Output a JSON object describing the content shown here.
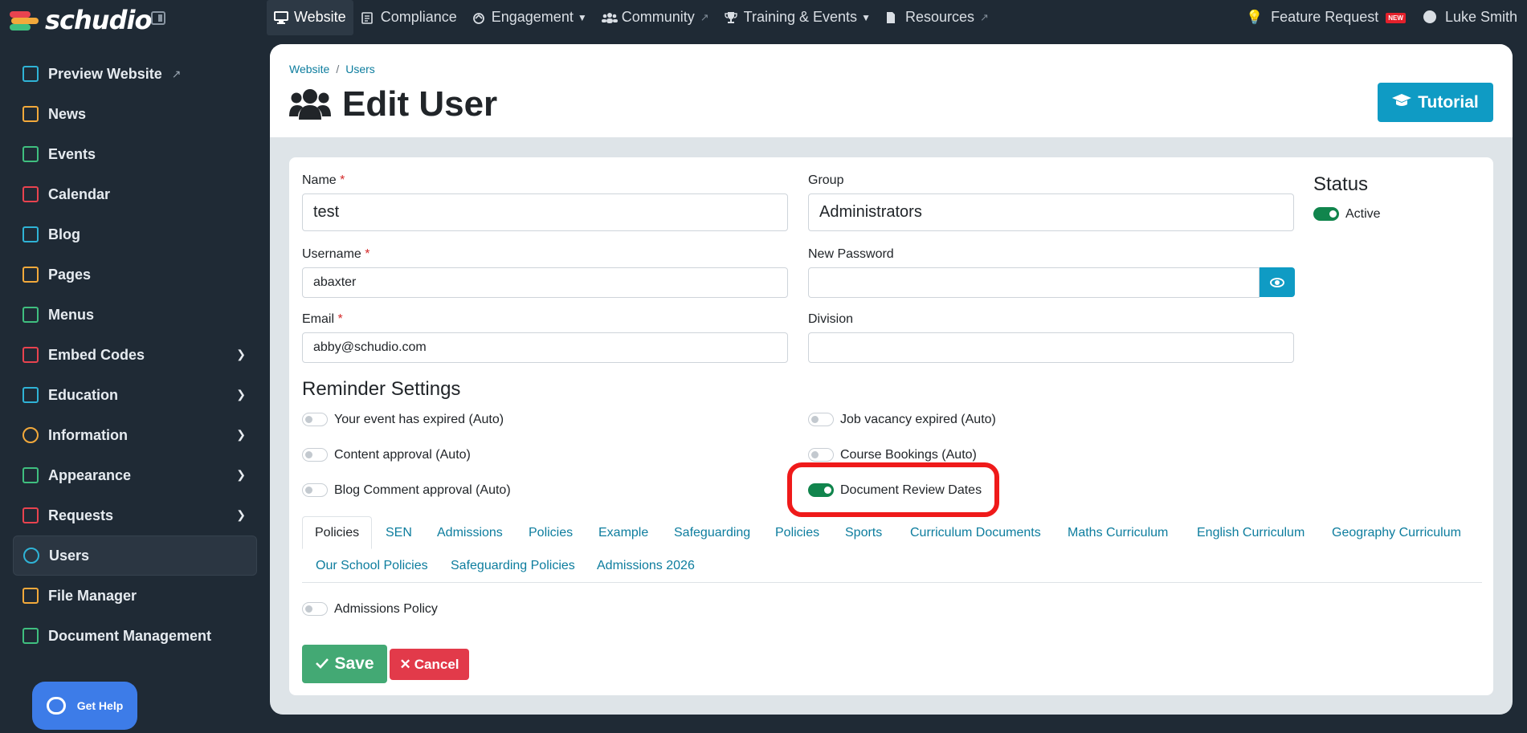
{
  "brand": {
    "name": "schudio"
  },
  "topnav": [
    {
      "label": "Website",
      "icon": "monitor-icon",
      "active": true
    },
    {
      "label": "Compliance",
      "icon": "clipboard-icon"
    },
    {
      "label": "Engagement",
      "icon": "hands-icon",
      "dropdown": true
    },
    {
      "label": "Community",
      "icon": "users-icon",
      "external": true
    },
    {
      "label": "Training & Events",
      "icon": "trophy-icon",
      "dropdown": true
    },
    {
      "label": "Resources",
      "icon": "file-icon",
      "external": true
    }
  ],
  "topright": {
    "feature_request": "Feature Request",
    "new_badge": "NEW",
    "user_name": "Luke Smith"
  },
  "sidebar": [
    {
      "label": "Preview Website",
      "icon": "preview-icon",
      "color": "#2fb3d6",
      "external": true
    },
    {
      "label": "News",
      "icon": "newspaper-icon",
      "color": "#f2a93b"
    },
    {
      "label": "Events",
      "icon": "calendar-check-icon",
      "color": "#3fbf7f"
    },
    {
      "label": "Calendar",
      "icon": "calendar-icon",
      "color": "#e8434f"
    },
    {
      "label": "Blog",
      "icon": "blog-icon",
      "color": "#2fb3d6"
    },
    {
      "label": "Pages",
      "icon": "pages-icon",
      "color": "#f2a93b"
    },
    {
      "label": "Menus",
      "icon": "menus-icon",
      "color": "#3fbf7f"
    },
    {
      "label": "Embed Codes",
      "icon": "code-icon",
      "color": "#e8434f",
      "chevron": true
    },
    {
      "label": "Education",
      "icon": "graduation-icon",
      "color": "#2fb3d6",
      "chevron": true
    },
    {
      "label": "Information",
      "icon": "info-icon",
      "color": "#f2a93b",
      "chevron": true
    },
    {
      "label": "Appearance",
      "icon": "appearance-icon",
      "color": "#3fbf7f",
      "chevron": true
    },
    {
      "label": "Requests",
      "icon": "requests-icon",
      "color": "#e8434f",
      "chevron": true
    },
    {
      "label": "Users",
      "icon": "users-icon",
      "color": "#2fb3d6",
      "active": true
    },
    {
      "label": "File Manager",
      "icon": "file-manager-icon",
      "color": "#f2a93b"
    },
    {
      "label": "Document Management",
      "icon": "document-icon",
      "color": "#3fbf7f"
    }
  ],
  "help": {
    "label": "Get Help"
  },
  "breadcrumb": {
    "first": "Website",
    "sep": "/",
    "second": "Users"
  },
  "page": {
    "title": "Edit User",
    "tutorial": "Tutorial"
  },
  "form": {
    "name_label": "Name",
    "name_value": "test",
    "group_label": "Group",
    "group_value": "Administrators",
    "username_label": "Username",
    "username_value": "abaxter",
    "password_label": "New Password",
    "password_value": "",
    "email_label": "Email",
    "email_value": "abby@schudio.com",
    "division_label": "Division",
    "division_value": "",
    "required_mark": "*"
  },
  "status": {
    "title": "Status",
    "label": "Active",
    "on": true
  },
  "reminders": {
    "title": "Reminder Settings",
    "left": [
      {
        "label": "Your event has expired (Auto)",
        "on": false
      },
      {
        "label": "Content approval (Auto)",
        "on": false
      },
      {
        "label": "Blog Comment approval (Auto)",
        "on": false
      }
    ],
    "right": [
      {
        "label": "Job vacancy expired (Auto)",
        "on": false
      },
      {
        "label": "Course Bookings (Auto)",
        "on": false
      },
      {
        "label": "Document Review Dates",
        "on": true
      }
    ]
  },
  "tabs": [
    "Policies",
    "SEN",
    "Admissions",
    "Policies",
    "Example",
    "Safeguarding",
    "Policies",
    "Sports",
    "Curriculum Documents",
    "Maths Curriculum",
    "English Curriculum",
    "Geography Curriculum",
    "Our School Policies",
    "Safeguarding Policies",
    "Admissions 2026"
  ],
  "tab_items": [
    {
      "label": "Admissions Policy",
      "on": false
    }
  ],
  "actions": {
    "save": "Save",
    "cancel": "Cancel"
  }
}
